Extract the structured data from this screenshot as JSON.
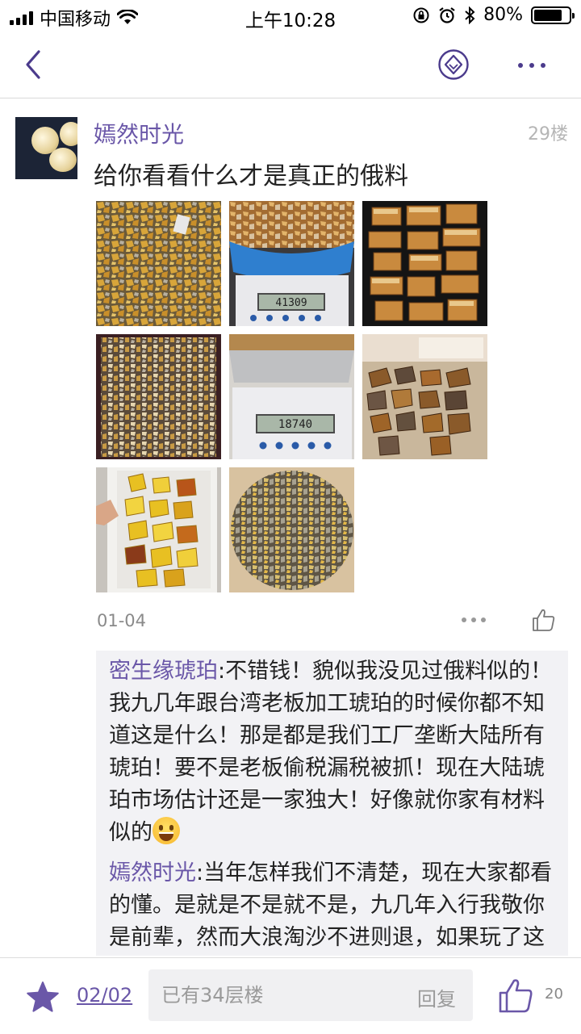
{
  "status_bar": {
    "carrier": "中国移动",
    "time": "上午10:28",
    "battery_percent": "80%",
    "battery_level": 0.8
  },
  "nav": {
    "icons": [
      "back-chevron-icon",
      "diamond-icon",
      "more-icon"
    ]
  },
  "post": {
    "username": "嫣然时光",
    "floor": "29楼",
    "text": "给你看看什么才是真正的俄料",
    "scale_readings": [
      "41309",
      "18740"
    ],
    "date": "01-04"
  },
  "comments": [
    {
      "author": "密生缘琥珀",
      "separator": ":",
      "text": "不错钱！貌似我没见过俄料似的！我九几年跟台湾老板加工琥珀的时候你都不知道这是什么！那是都是我们工厂垄断大陆所有琥珀！要不是老板偷税漏税被抓！现在大陆琥珀市场估计还是一家独大！好像就你家有材料似的",
      "emoji": "grinning-face-emoji"
    },
    {
      "author": "嫣然时光",
      "separator": ":",
      "text": "当年怎样我们不清楚，现在大家都看的懂。是就是不是就不是，九几年入行我敬你是前辈，然而大浪淘沙不进则退，如果玩了这么多年玩成这样，我就不服气你是真的不服气还是真的不服气"
    }
  ],
  "bottom_bar": {
    "page": "02/02",
    "reply_placeholder": "已有34层楼",
    "reply_label": "回复",
    "like_count": "20"
  },
  "colors": {
    "accent": "#6a57a8",
    "comment_bg": "#f2f2f5"
  }
}
